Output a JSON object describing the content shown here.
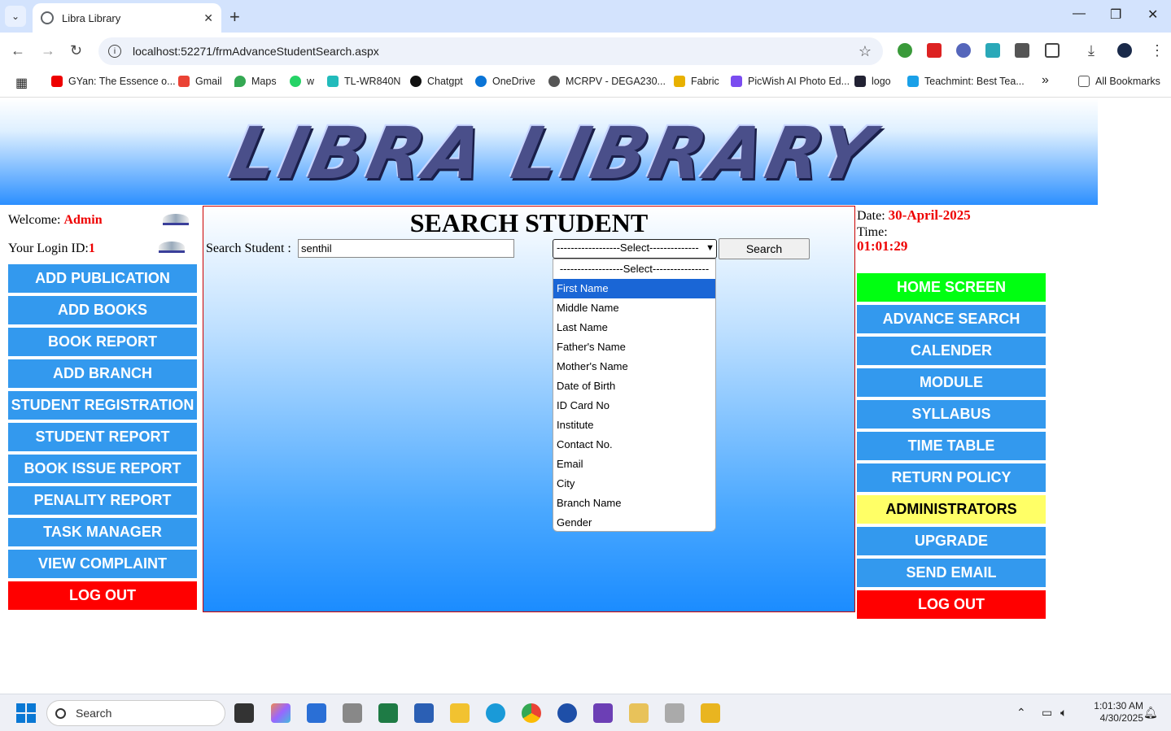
{
  "browser": {
    "tab_title": "Libra Library",
    "url": "localhost:52271/frmAdvanceStudentSearch.aspx",
    "bookmarks": [
      "GYan: The Essence o...",
      "Gmail",
      "Maps",
      "w",
      "TL-WR840N",
      "Chatgpt",
      "OneDrive",
      "MCRPV - DEGA230...",
      "Fabric",
      "PicWish AI Photo Ed...",
      "logo",
      "Teachmint: Best Tea..."
    ],
    "all_bookmarks": "All Bookmarks",
    "more": "»"
  },
  "header": {
    "logo_text": "LIBRA LIBRARY"
  },
  "left": {
    "welcome_label": "Welcome: ",
    "welcome_user": "Admin",
    "login_label": "Your Login ID:",
    "login_id": "1",
    "nav": [
      "ADD PUBLICATION",
      "ADD BOOKS",
      "BOOK REPORT",
      "ADD BRANCH",
      "STUDENT REGISTRATION",
      "STUDENT REPORT",
      "BOOK ISSUE REPORT",
      "PENALITY REPORT",
      "TASK MANAGER",
      "VIEW COMPLAINT",
      "LOG OUT"
    ]
  },
  "main": {
    "title": "SEARCH STUDENT",
    "search_label": "Search Student :",
    "search_value": "senthil",
    "select_value": "------------------Select--------------",
    "search_button": "Search",
    "options": [
      "------------------Select----------------",
      "First Name",
      "Middle Name",
      "Last Name",
      "Father's Name",
      "Mother's Name",
      "Date of Birth",
      "ID Card No",
      "Institute",
      "Contact No.",
      "Email",
      "City",
      "Branch Name",
      "Gender"
    ],
    "highlighted_option": "First Name"
  },
  "right": {
    "date_label": "Date: ",
    "date_value": "30-April-2025",
    "time_label": "Time:",
    "time_value": "01:01:29",
    "nav": [
      "HOME SCREEN",
      "ADVANCE SEARCH",
      "CALENDER",
      "MODULE",
      "SYLLABUS",
      "TIME TABLE",
      "RETURN POLICY",
      "ADMINISTRATORS",
      "UPGRADE",
      "SEND EMAIL",
      "LOG OUT"
    ]
  },
  "taskbar": {
    "search_placeholder": "Search",
    "time": "1:01:30 AM",
    "date": "4/30/2025"
  }
}
